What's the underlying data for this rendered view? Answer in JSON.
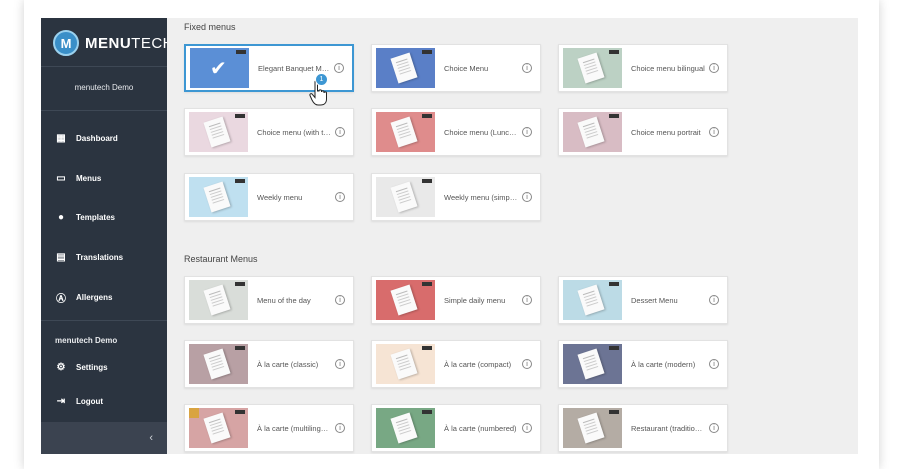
{
  "sidebar": {
    "logo_letter": "M",
    "logo_text_bold": "MENU",
    "logo_text_rest": "TECH",
    "account_name": "menutech Demo",
    "nav": [
      {
        "label": "Dashboard",
        "icon": "dashboard-icon"
      },
      {
        "label": "Menus",
        "icon": "book-icon"
      },
      {
        "label": "Templates",
        "icon": "palette-icon"
      },
      {
        "label": "Translations",
        "icon": "translate-icon"
      },
      {
        "label": "Allergens",
        "icon": "allergen-icon"
      }
    ],
    "user_name": "menutech Demo",
    "settings_label": "Settings",
    "logout_label": "Logout",
    "collapse_glyph": "‹"
  },
  "sections": {
    "fixed_title": "Fixed menus",
    "restaurant_title": "Restaurant Menus"
  },
  "fixed_menus": [
    {
      "label": "Elegant Banquet Me...",
      "color": "#5b8fd6"
    },
    {
      "label": "Choice Menu",
      "color": "#5a7fc7"
    },
    {
      "label": "Choice menu bilingual",
      "color": "#bcd1c4"
    },
    {
      "label": "Choice menu (with titl...",
      "color": "#ead8e0"
    },
    {
      "label": "Choice menu (Lunch-...",
      "color": "#df8c8c"
    },
    {
      "label": "Choice menu portrait",
      "color": "#d8bcc4"
    },
    {
      "label": "Weekly menu",
      "color": "#bfe0f0"
    },
    {
      "label": "Weekly menu (simple)",
      "color": "#e9e9e9"
    }
  ],
  "restaurant_menus": [
    {
      "label": "Menu of the day",
      "color": "#d9ddd9"
    },
    {
      "label": "Simple daily menu",
      "color": "#d86c6c"
    },
    {
      "label": "Dessert Menu",
      "color": "#bcdbe6"
    },
    {
      "label": "À la carte (classic)",
      "color": "#b8a0a4"
    },
    {
      "label": "À la carte (compact)",
      "color": "#f6e4d4"
    },
    {
      "label": "À la carte (modern)",
      "color": "#6c7494"
    },
    {
      "label": "À la carte (multilingual)",
      "color": "#d6a4a4"
    },
    {
      "label": "À la carte (numbered)",
      "color": "#78a884"
    },
    {
      "label": "Restaurant (traditional)",
      "color": "#b4aca4"
    }
  ],
  "info_glyph": "i",
  "cursor_badge": "1",
  "check_glyph": "✔"
}
